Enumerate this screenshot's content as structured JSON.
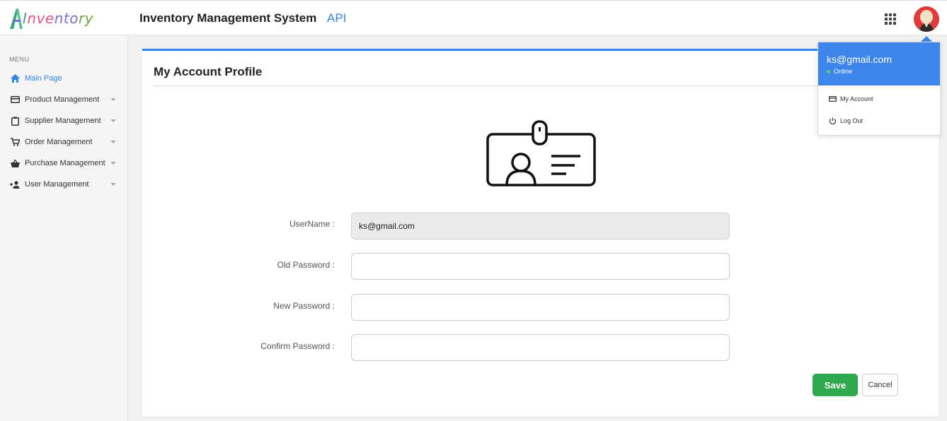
{
  "header": {
    "logo_parts": [
      "I",
      "nve",
      "nto",
      "ry"
    ],
    "title": "Inventory Management System",
    "api_label": "API"
  },
  "sidebar": {
    "menu_label": "MENU",
    "items": [
      {
        "label": "Main Page",
        "icon": "home-icon",
        "active": true,
        "has_caret": false
      },
      {
        "label": "Product Management",
        "icon": "card-icon",
        "active": false,
        "has_caret": true
      },
      {
        "label": "Supplier Management",
        "icon": "clipboard-icon",
        "active": false,
        "has_caret": true
      },
      {
        "label": "Order Management",
        "icon": "cart-icon",
        "active": false,
        "has_caret": true
      },
      {
        "label": "Purchase Management",
        "icon": "basket-icon",
        "active": false,
        "has_caret": true
      },
      {
        "label": "User Management",
        "icon": "add-user-icon",
        "active": false,
        "has_caret": true
      }
    ]
  },
  "main": {
    "title": "My Account Profile",
    "form": {
      "username_label": "UserName :",
      "username_value": "ks@gmail.com",
      "old_password_label": "Old Password :",
      "old_password_value": "",
      "new_password_label": "New Password :",
      "new_password_value": "",
      "confirm_password_label": "Confirm Password :",
      "confirm_password_value": ""
    },
    "save_label": "Save",
    "cancel_label": "Cancel"
  },
  "dropdown": {
    "email": "ks@gmail.com",
    "status": "Online",
    "items": [
      {
        "label": "My Account",
        "icon": "card-icon"
      },
      {
        "label": "Log Out",
        "icon": "power-icon"
      }
    ]
  },
  "colors": {
    "accent": "#2f86e8",
    "save": "#2fa84f",
    "dropdown_header": "#3d85ea",
    "online": "#4cd964"
  }
}
